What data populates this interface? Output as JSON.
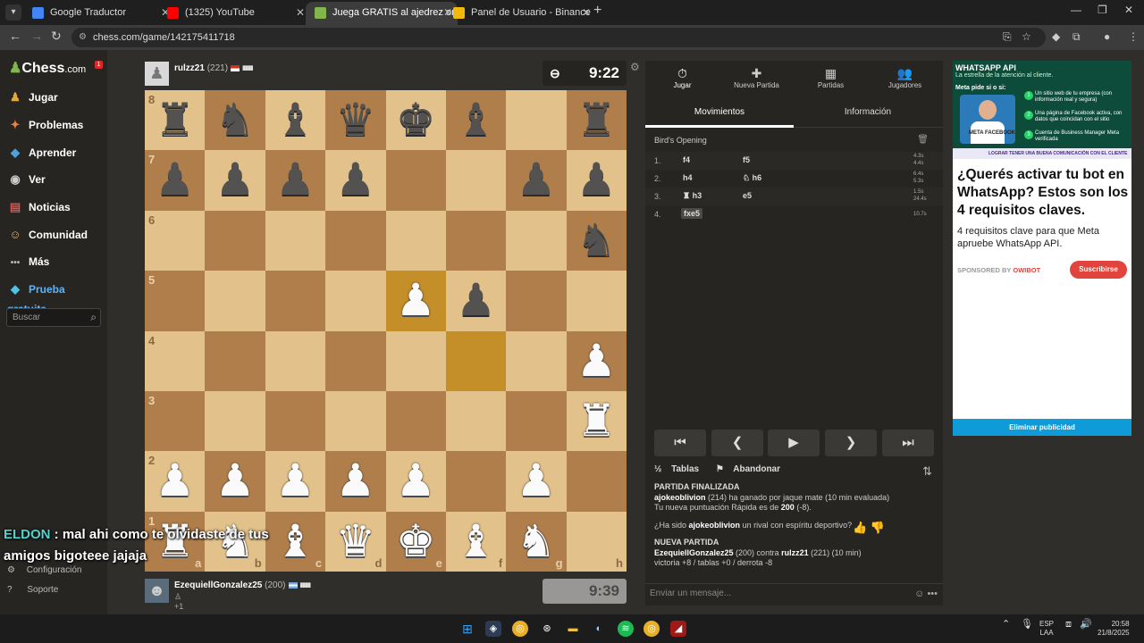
{
  "browser": {
    "tabs": [
      {
        "title": "Google Traductor",
        "color": "#4285f4",
        "active": false
      },
      {
        "title": "(1325) YouTube",
        "color": "#ff0000",
        "active": false
      },
      {
        "title": "Juega GRATIS al ajedrez online",
        "color": "#81b64c",
        "active": true
      },
      {
        "title": "Panel de Usuario - Binance",
        "color": "#f0b90b",
        "active": false
      }
    ],
    "url": "chess.com/game/142175411718"
  },
  "sidebar": {
    "logo": "Chess",
    "logo_suffix": ".com",
    "notif_count": "1",
    "items": [
      {
        "label": "Jugar",
        "icon": "♟"
      },
      {
        "label": "Problemas",
        "icon": "✦"
      },
      {
        "label": "Aprender",
        "icon": "◆"
      },
      {
        "label": "Ver",
        "icon": "◉"
      },
      {
        "label": "Noticias",
        "icon": "▤"
      },
      {
        "label": "Comunidad",
        "icon": "☺"
      },
      {
        "label": "Más",
        "icon": "•••"
      },
      {
        "label": "Prueba gratuita",
        "icon": "◆"
      }
    ],
    "search_placeholder": "Buscar",
    "footer": [
      {
        "label": "Configuración",
        "icon": "⚙"
      },
      {
        "label": "Soporte",
        "icon": "?"
      }
    ]
  },
  "top_player": {
    "name": "rulzz21",
    "rating": "(221)",
    "clock": "9:22"
  },
  "bottom_player": {
    "name": "EzequiellGonzalez25",
    "rating": "(200)",
    "sub": "+1",
    "clock": "9:39"
  },
  "board": {
    "light": "#e3c18b",
    "dark": "#b07e4b",
    "position": [
      [
        "bR",
        "bN",
        "bB",
        "bQ",
        "bK",
        "bB",
        "",
        "bR"
      ],
      [
        "bP",
        "bP",
        "bP",
        "bP",
        "",
        "",
        "bP",
        "bP"
      ],
      [
        "",
        "",
        "",
        "",
        "",
        "",
        "",
        "bN"
      ],
      [
        "",
        "",
        "",
        "",
        "wP",
        "bP",
        "",
        ""
      ],
      [
        "",
        "",
        "",
        "",
        "",
        "",
        "",
        "wP"
      ],
      [
        "",
        "",
        "",
        "",
        "",
        "",
        "",
        "wR"
      ],
      [
        "wP",
        "wP",
        "wP",
        "wP",
        "wP",
        "",
        "wP",
        ""
      ],
      [
        "wR",
        "wN",
        "wB",
        "wQ",
        "wK",
        "wB",
        "wN",
        ""
      ]
    ],
    "highlight": [
      [
        3,
        4
      ],
      [
        4,
        5
      ]
    ],
    "ranks": [
      "8",
      "7",
      "6",
      "5",
      "4",
      "3",
      "2",
      "1"
    ],
    "files": [
      "a",
      "b",
      "c",
      "d",
      "e",
      "f",
      "g",
      "h"
    ]
  },
  "panel": {
    "tabs": [
      {
        "label": "Jugar",
        "icon": "⏱"
      },
      {
        "label": "Nueva Partida",
        "icon": "✚"
      },
      {
        "label": "Partidas",
        "icon": "▦"
      },
      {
        "label": "Jugadores",
        "icon": "👥"
      }
    ],
    "subtabs": [
      "Movimientos",
      "Información"
    ],
    "opening": "Bird's Opening",
    "moves": [
      {
        "num": "1.",
        "white": "f4",
        "black": "f5",
        "times": [
          "4.3s",
          "4.4s"
        ]
      },
      {
        "num": "2.",
        "white": "h4",
        "black": "♘ h6",
        "times": [
          "6.4s",
          "5.3s"
        ]
      },
      {
        "num": "3.",
        "white": "♜ h3",
        "black": "e5",
        "times": [
          "1.5s",
          "24.4s"
        ]
      },
      {
        "num": "4.",
        "white": "fxe5",
        "black": "",
        "times": [
          "10.7s",
          ""
        ]
      }
    ],
    "controls": [
      "⏮",
      "❮",
      "▶",
      "❯",
      "⏭"
    ],
    "draw_label": "Tablas",
    "resign_label": "Abandonar",
    "chat": {
      "finished_header": "PARTIDA FINALIZADA",
      "winner": "ajokeoblivion",
      "result_text": "(214) ha ganado por jaque mate (10 min evaluada)",
      "rating_prefix": "Tu nueva puntuación Rápida es de",
      "rating_value": "200",
      "rating_suffix": "(-8).",
      "rival_prefix": "¿Ha sido",
      "rival_name": "ajokeoblivion",
      "rival_suffix": "un rival con espíritu deportivo?",
      "new_header": "NUEVA PARTIDA",
      "new_p1": "EzequiellGonzalez25",
      "new_p1_rating": "(200) contra",
      "new_p2": "rulzz21",
      "new_p2_rating": "(221) (10 min)",
      "stats": "victoria +8 / tablas +0 / derrota -8"
    },
    "message_placeholder": "Enviar un mensaje..."
  },
  "ad": {
    "top_title": "WHATSAPP API",
    "top_sub": "La estrella de la atención al cliente.",
    "top_q": "Meta pide si o si:",
    "badge": "META FACEBOOK",
    "items": [
      {
        "n": "1",
        "text": "Un sitio web de tu empresa (con información real y segura)"
      },
      {
        "n": "2",
        "text": "Una página de Facebook activa, con datos que coincidan con el sitio"
      },
      {
        "n": "3",
        "text": "Cuenta de Business Manager Meta verificada"
      }
    ],
    "strip": "LOGRAR TENER UNA BUENA COMUNICACIÓN CON EL CLIENTE",
    "title": "¿Querés activar tu bot en WhatsApp? Estos son los 4 requisitos claves.",
    "desc": "4 requisitos clave para que Meta apruebe WhatsApp API.",
    "sponsored_by": "SPONSORED BY",
    "sponsor": "OWIBOT",
    "cta": "Suscribirse",
    "remove": "Eliminar publicidad"
  },
  "subtitle": {
    "speaker": "ELDON",
    "line1": ": mal ahi como te olvidaste de tus",
    "line2": "amigos bigoteee jajaja"
  },
  "taskbar": {
    "lang": "ESP",
    "lang2": "LAA",
    "time": "20:58",
    "date": "21/8/2025"
  }
}
